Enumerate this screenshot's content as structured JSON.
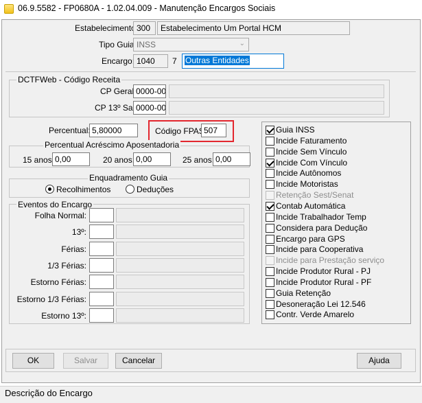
{
  "window": {
    "title": "06.9.5582 - FP0680A - 1.02.04.009 - Manutenção Encargos Sociais"
  },
  "header": {
    "estabelecimento_label": "Estabelecimento:",
    "estabelecimento_code": "300",
    "estabelecimento_name": "Estabelecimento Um Portal HCM",
    "tipo_guia_label": "Tipo Guia:",
    "tipo_guia_value": "INSS",
    "encargo_label": "Encargo:",
    "encargo_code": "1040",
    "encargo_num": "7",
    "encargo_desc": "Outras Entidades"
  },
  "dctfweb": {
    "title": "DCTFWeb - Código Receita",
    "cp_geral_label": "CP Geral:",
    "cp_geral_value": "0000-00",
    "cp_13_label": "CP 13º Sal:",
    "cp_13_value": "0000-00"
  },
  "percentual": {
    "label": "Percentual:",
    "value": "5,80000"
  },
  "fpas": {
    "label": "Código FPAS:",
    "value": "507"
  },
  "acrescimo": {
    "title": "Percentual Acréscimo Aposentadoria",
    "anos15_label": "15 anos:",
    "anos15_value": "0,00",
    "anos20_label": "20 anos:",
    "anos20_value": "0,00",
    "anos25_label": "25 anos:",
    "anos25_value": "0,00"
  },
  "enquadramento": {
    "title": "Enquadramento Guia",
    "recolhimentos": "Recolhimentos",
    "deducoes": "Deduções"
  },
  "eventos": {
    "title": "Eventos do Encargo",
    "rows": [
      {
        "label": "Folha Normal:"
      },
      {
        "label": "13º:"
      },
      {
        "label": "Férias:"
      },
      {
        "label": "1/3 Férias:"
      },
      {
        "label": "Estorno Férias:"
      },
      {
        "label": "Estorno 1/3 Férias:"
      },
      {
        "label": "Estorno 13º:"
      }
    ]
  },
  "options": [
    {
      "label": "Guia INSS",
      "checked": true,
      "disabled": false
    },
    {
      "label": "Incide Faturamento",
      "checked": false,
      "disabled": false
    },
    {
      "label": "Incide Sem Vínculo",
      "checked": false,
      "disabled": false
    },
    {
      "label": "Incide Com Vínculo",
      "checked": true,
      "disabled": false
    },
    {
      "label": "Incide Autônomos",
      "checked": false,
      "disabled": false
    },
    {
      "label": "Incide Motoristas",
      "checked": false,
      "disabled": false
    },
    {
      "label": "Retenção Sest/Senat",
      "checked": false,
      "disabled": true
    },
    {
      "label": "Contab Automática",
      "checked": true,
      "disabled": false
    },
    {
      "label": "Incide Trabalhador Temp",
      "checked": false,
      "disabled": false
    },
    {
      "label": "Considera para Dedução",
      "checked": false,
      "disabled": false
    },
    {
      "label": "Encargo para GPS",
      "checked": false,
      "disabled": false
    },
    {
      "label": "Incide para Cooperativa",
      "checked": false,
      "disabled": false
    },
    {
      "label": "Incide para Prestação serviço",
      "checked": false,
      "disabled": true
    },
    {
      "label": "Incide Produtor Rural - PJ",
      "checked": false,
      "disabled": false
    },
    {
      "label": "Incide Produtor Rural - PF",
      "checked": false,
      "disabled": false
    },
    {
      "label": "Guia Retenção",
      "checked": false,
      "disabled": false
    },
    {
      "label": "Desoneração Lei 12.546",
      "checked": false,
      "disabled": false
    },
    {
      "label": "Contr. Verde Amarelo",
      "checked": false,
      "disabled": false
    }
  ],
  "buttons": {
    "ok": "OK",
    "salvar": "Salvar",
    "cancelar": "Cancelar",
    "ajuda": "Ajuda"
  },
  "status": {
    "text": "Descrição do Encargo"
  },
  "colors": {
    "highlight": "#e3262e",
    "selection": "#0078d7"
  }
}
